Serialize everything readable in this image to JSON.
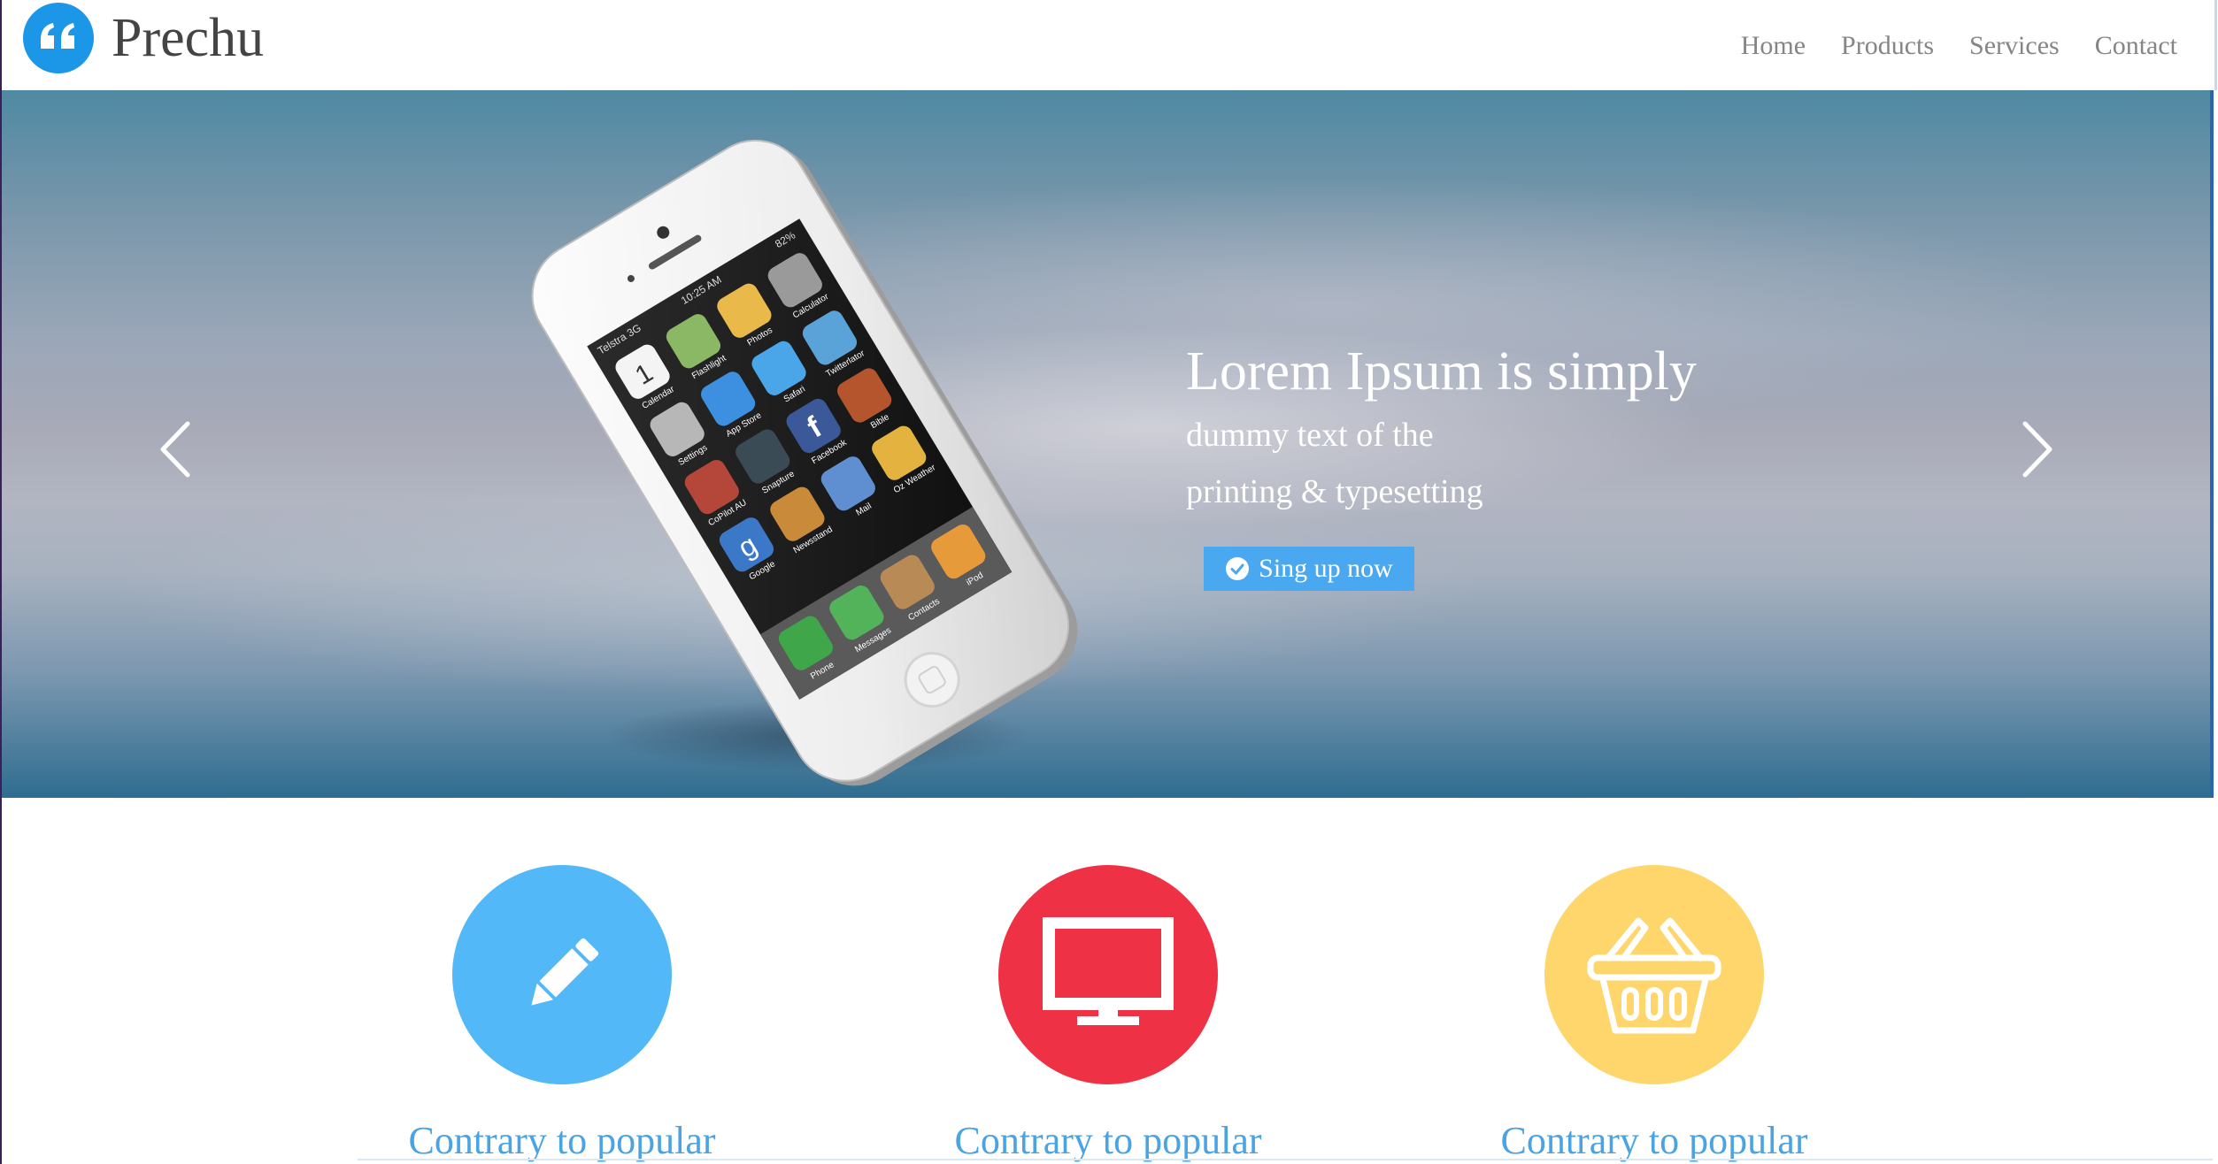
{
  "header": {
    "brand": "Prechu",
    "logo_icon": "quote-icon",
    "nav": [
      {
        "label": "Home"
      },
      {
        "label": "Products"
      },
      {
        "label": "Services"
      },
      {
        "label": "Contact"
      }
    ]
  },
  "hero": {
    "title": "Lorem Ipsum is simply",
    "line1": "dummy text of the",
    "line2": "printing & typesetting",
    "cta_label": "Sing up now",
    "cta_icon": "check-circle-icon",
    "prev_icon": "chevron-left-icon",
    "next_icon": "chevron-right-icon",
    "image": "smartphone-image",
    "phone_screen": {
      "carrier": "Telstra 3G",
      "time": "10:25 AM",
      "battery": "82%",
      "apps": [
        "Calendar",
        "Flashlight",
        "Photos",
        "Calculator",
        "Settings",
        "App Store",
        "Safari",
        "Twitterlator",
        "CoPilot AU",
        "Snapture",
        "Facebook",
        "Bible",
        "Google",
        "Newsstand",
        "Mail",
        "Oz Weather",
        "Phone",
        "Messages",
        "Contacts",
        "iPod"
      ],
      "calendar_day": "1"
    }
  },
  "features": [
    {
      "title": "Contrary to popular",
      "icon": "pencil-icon",
      "color": "#52b8f8"
    },
    {
      "title": "Contrary to popular",
      "icon": "monitor-icon",
      "color": "#ee3145"
    },
    {
      "title": "Contrary to popular",
      "icon": "shopping-basket-icon",
      "color": "#fed66b"
    }
  ],
  "colors": {
    "logo": "#1c96e6",
    "button": "#4aa8f0",
    "feature_title": "#4aa3e2",
    "nav_text": "#858585"
  }
}
